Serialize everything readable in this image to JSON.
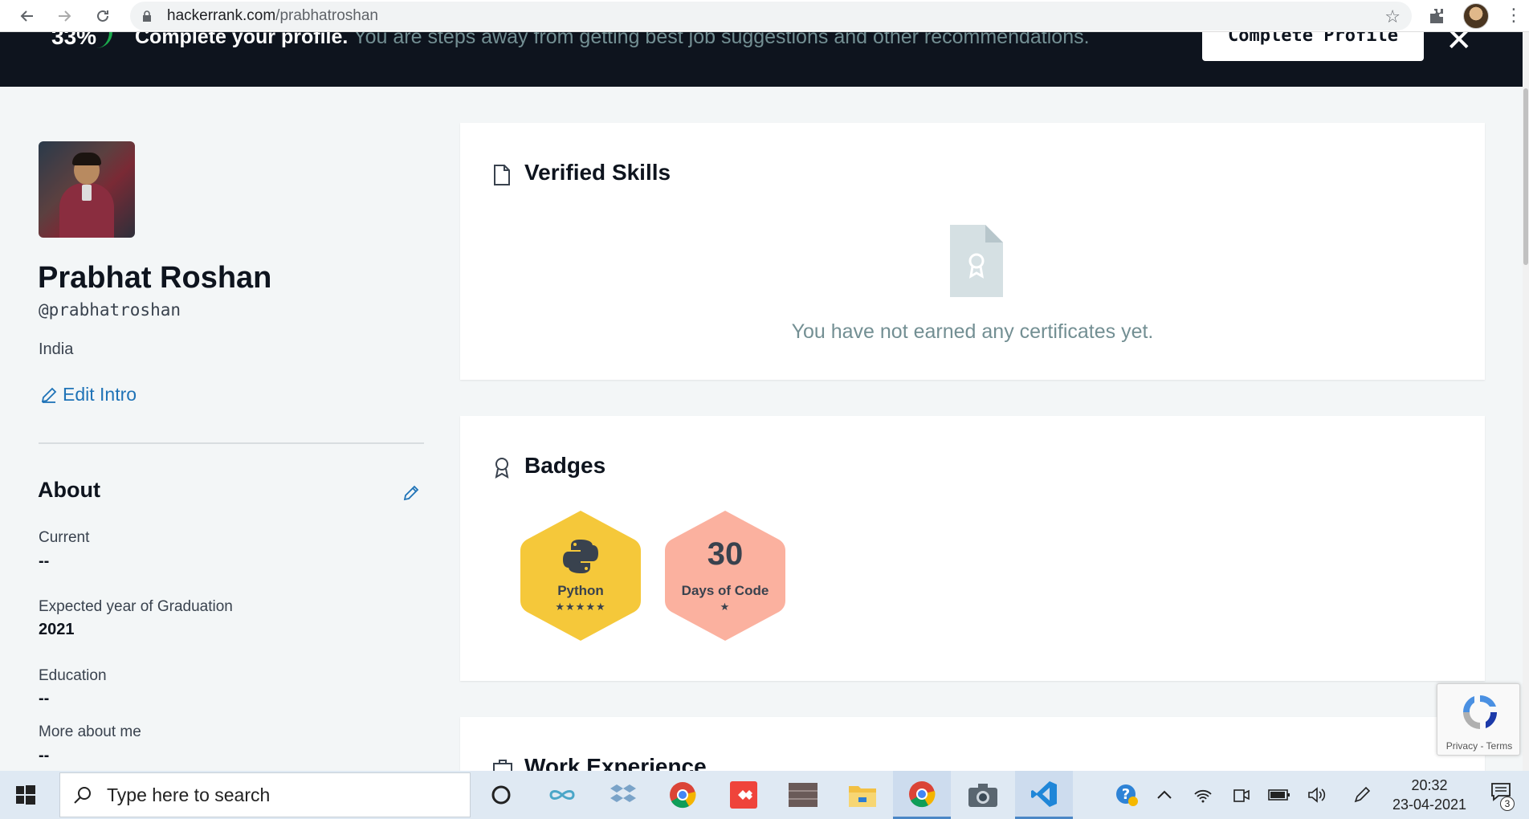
{
  "browser": {
    "url_domain": "hackerrank.com",
    "url_path": "/prabhatroshan"
  },
  "banner": {
    "percent": "33%",
    "headline": "Complete your profile.",
    "subtext": "You are steps away from getting best job suggestions and other recommendations.",
    "cta_label": "Complete Profile"
  },
  "profile": {
    "name": "Prabhat Roshan",
    "handle": "@prabhatroshan",
    "country": "India",
    "edit_intro_label": "Edit Intro"
  },
  "about": {
    "title": "About",
    "fields": [
      {
        "label": "Current",
        "value": "--"
      },
      {
        "label": "Expected year of Graduation",
        "value": "2021"
      },
      {
        "label": "Education",
        "value": "--"
      },
      {
        "label": "More about me",
        "value": "--"
      }
    ]
  },
  "verified_skills": {
    "title": "Verified Skills",
    "empty_message": "You have not earned any certificates yet."
  },
  "badges": {
    "title": "Badges",
    "items": [
      {
        "name": "Python",
        "stars": "★★★★★",
        "color": "#f5c83a",
        "icon": "python-icon"
      },
      {
        "name": "Days of Code",
        "number": "30",
        "stars": "★",
        "color": "#fbb19f",
        "icon": "days-of-code-icon"
      }
    ]
  },
  "work_experience": {
    "title": "Work Experience"
  },
  "recaptcha": {
    "links": "Privacy - Terms"
  },
  "taskbar": {
    "search_placeholder": "Type here to search",
    "time": "20:32",
    "date": "23-04-2021",
    "notification_count": "3"
  }
}
